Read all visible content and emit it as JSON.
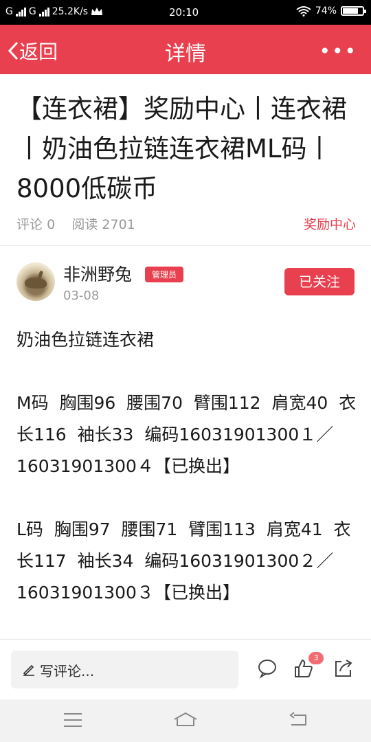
{
  "status_bar": {
    "carrier1": "G",
    "carrier2": "G",
    "speed": "25.2K/s",
    "time": "20:10",
    "battery": "74%"
  },
  "nav": {
    "back_label": "返回",
    "title": "详情",
    "more_label": "•••"
  },
  "article": {
    "title": "【连衣裙】奖励中心丨连衣裙丨奶油色拉链连衣裙ML码丨8000低碳币",
    "comments_label": "评论",
    "comments_count": "0",
    "reads_label": "阅读",
    "reads_count": "2701",
    "category": "奖励中心"
  },
  "author": {
    "name": "非洲野兔",
    "role_badge": "管理员",
    "date": "03-08",
    "follow_label": "已关注"
  },
  "body": {
    "para1": "奶油色拉链连衣裙",
    "para2": "M码  胸围96  腰围70  臂围112  肩宽40  衣长116  袖长33  编码16031901300１／16031901300４【已换出】",
    "para3": "L码  胸围97  腰围71  臂围113  肩宽41  衣长117  袖长34  编码16031901300２／16031901300３【已换出】"
  },
  "bottom": {
    "comment_placeholder": "写评论...",
    "like_count": "3"
  },
  "icons": {
    "back": "chevron-left-icon",
    "more": "more-icon",
    "comment": "comment-bubble-icon",
    "like": "thumbs-up-icon",
    "share": "share-icon"
  },
  "colors": {
    "accent": "#e8404e",
    "status_bar": "#000000",
    "system_nav": "#f2f2f2"
  }
}
